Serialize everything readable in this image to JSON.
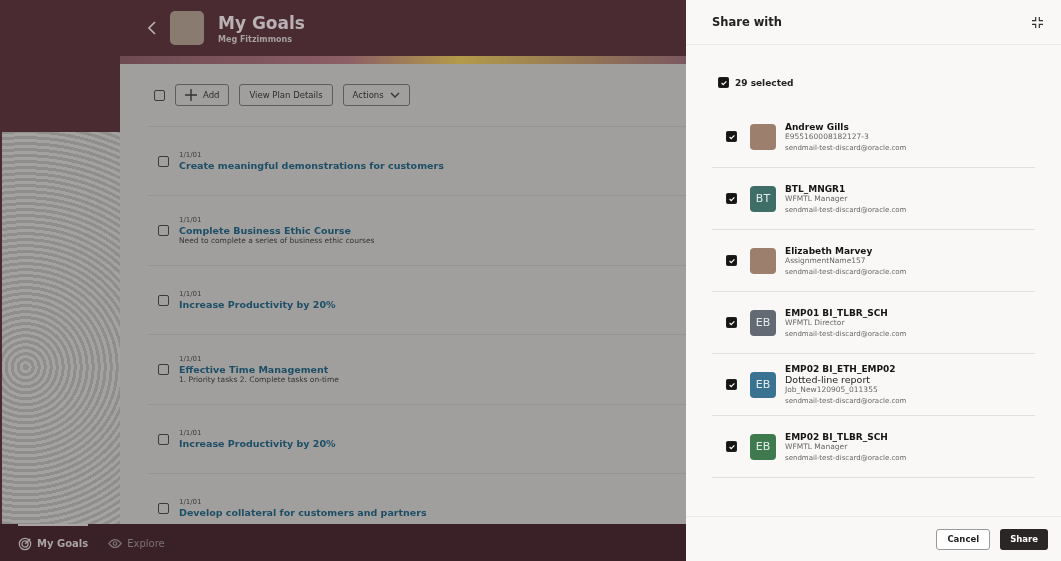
{
  "header": {
    "title": "My Goals",
    "subtitle": "Meg Fitzimmons"
  },
  "toolbar": {
    "select_all_checked": false,
    "add_label": "Add",
    "view_label": "View Plan Details",
    "actions_label": "Actions"
  },
  "goals": [
    {
      "date": "1/1/01",
      "title": "Create meaningful demonstrations for customers",
      "checked": false
    },
    {
      "date": "1/1/01",
      "title": "Complete Business Ethic Course",
      "description": "Need to complete a series of business ethic courses",
      "checked": false
    },
    {
      "date": "1/1/01",
      "title": "Increase Productivity by 20%",
      "checked": false
    },
    {
      "date": "1/1/01",
      "title": "Effective Time Management",
      "description": "1. Priority tasks 2. Complete tasks on-time",
      "checked": false
    },
    {
      "date": "1/1/01",
      "title": "Increase Productivity by 20%",
      "checked": false
    },
    {
      "date": "1/1/01",
      "title": "Develop collateral for customers and partners",
      "checked": false
    }
  ],
  "nav": [
    {
      "label": "My Goals",
      "selected": true,
      "kind": "target"
    },
    {
      "label": "Explore",
      "selected": false,
      "kind": "eye"
    }
  ],
  "drawer": {
    "title": "Share with",
    "select_all_checked": true,
    "selected_count": "29 selected",
    "people": [
      {
        "name": "Andrew Gills",
        "lines": [
          "E955160008182127-3"
        ],
        "email": "sendmail-test-discard@oracle.com",
        "checked": true,
        "avatar": {
          "kind": "photo"
        }
      },
      {
        "name": "BTL_MNGR1",
        "lines": [
          "WFMTL Manager"
        ],
        "email": "sendmail-test-discard@oracle.com",
        "checked": true,
        "avatar": {
          "kind": "initials",
          "initials": "BT",
          "color": "#3f6e69"
        }
      },
      {
        "name": "Elizabeth Marvey",
        "lines": [
          "AssignmentName157"
        ],
        "email": "sendmail-test-discard@oracle.com",
        "checked": true,
        "avatar": {
          "kind": "photo"
        }
      },
      {
        "name": "EMP01 BI_TLBR_SCH",
        "lines": [
          "WFMTL Director"
        ],
        "email": "sendmail-test-discard@oracle.com",
        "checked": true,
        "avatar": {
          "kind": "initials",
          "initials": "EB",
          "color": "#646a73"
        }
      },
      {
        "name": "EMP02 BI_ETH_EMP02",
        "relation": "Dotted-line report",
        "lines": [
          "Job_New120905_011355"
        ],
        "email": "sendmail-test-discard@oracle.com",
        "checked": true,
        "avatar": {
          "kind": "initials",
          "initials": "EB",
          "color": "#3a7291"
        }
      },
      {
        "name": "EMP02 BI_TLBR_SCH",
        "lines": [
          "WFMTL Manager"
        ],
        "email": "sendmail-test-discard@oracle.com",
        "checked": true,
        "avatar": {
          "kind": "initials",
          "initials": "EB",
          "color": "#3f7a4f"
        }
      }
    ],
    "cancel_label": "Cancel",
    "share_label": "Share"
  }
}
